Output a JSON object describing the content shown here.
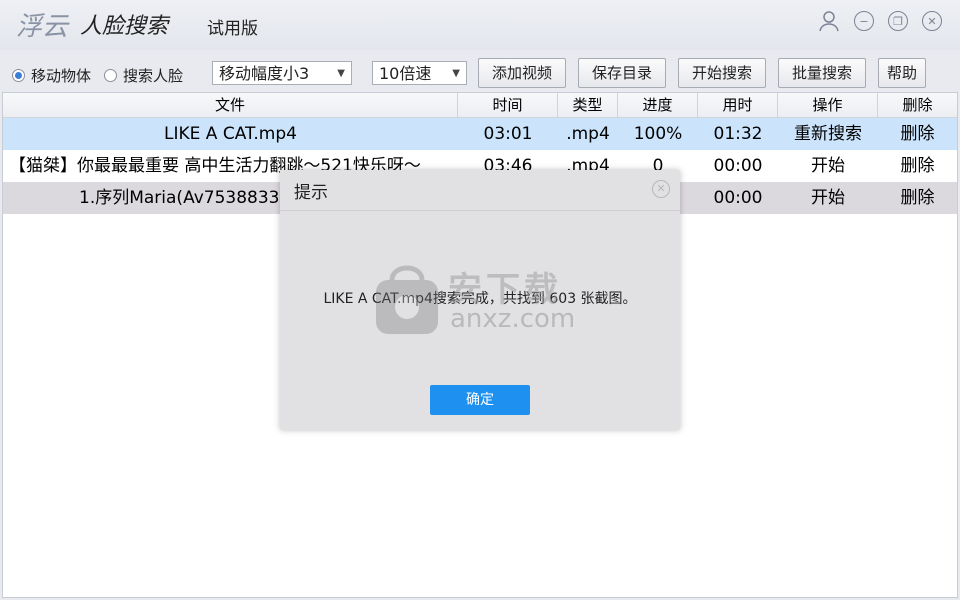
{
  "app": {
    "logo_main": "浮云",
    "logo_sub": "人脸搜索",
    "edition": "试用版"
  },
  "toolbar": {
    "radio_moving": "移动物体",
    "radio_face": "搜索人脸",
    "selected_radio": "移动物体",
    "amplitude_select": "移动幅度小3",
    "speed_select": "10倍速",
    "add_video": "添加视频",
    "save_dir": "保存目录",
    "start_search": "开始搜索",
    "batch_search": "批量搜索",
    "help": "帮助"
  },
  "table": {
    "headers": {
      "file": "文件",
      "time": "时间",
      "type": "类型",
      "progress": "进度",
      "elapsed": "用时",
      "action": "操作",
      "delete": "删除"
    },
    "rows": [
      {
        "file": "LIKE A CAT.mp4",
        "time": "03:01",
        "type": ".mp4",
        "progress": "100%",
        "elapsed": "01:32",
        "action": "重新搜索",
        "delete": "删除"
      },
      {
        "file": "【猫桀】你最最最重要 高中生活力翻跳～521快乐呀～",
        "time": "03:46",
        "type": ".mp4",
        "progress": "0",
        "elapsed": "00:00",
        "action": "开始",
        "delete": "删除"
      },
      {
        "file": "1.序列Maria(Av7538833",
        "time": "",
        "type": "",
        "progress": "",
        "elapsed": "00:00",
        "action": "开始",
        "delete": "删除"
      }
    ]
  },
  "dialog": {
    "title": "提示",
    "message": "LIKE A CAT.mp4搜索完成，共找到 603 张截图。",
    "ok": "确定"
  },
  "watermark": {
    "main": "安下载",
    "sub": "anxz.com"
  },
  "colors": {
    "accent": "#1e90ef",
    "selected_row": "#cbe4fb"
  }
}
